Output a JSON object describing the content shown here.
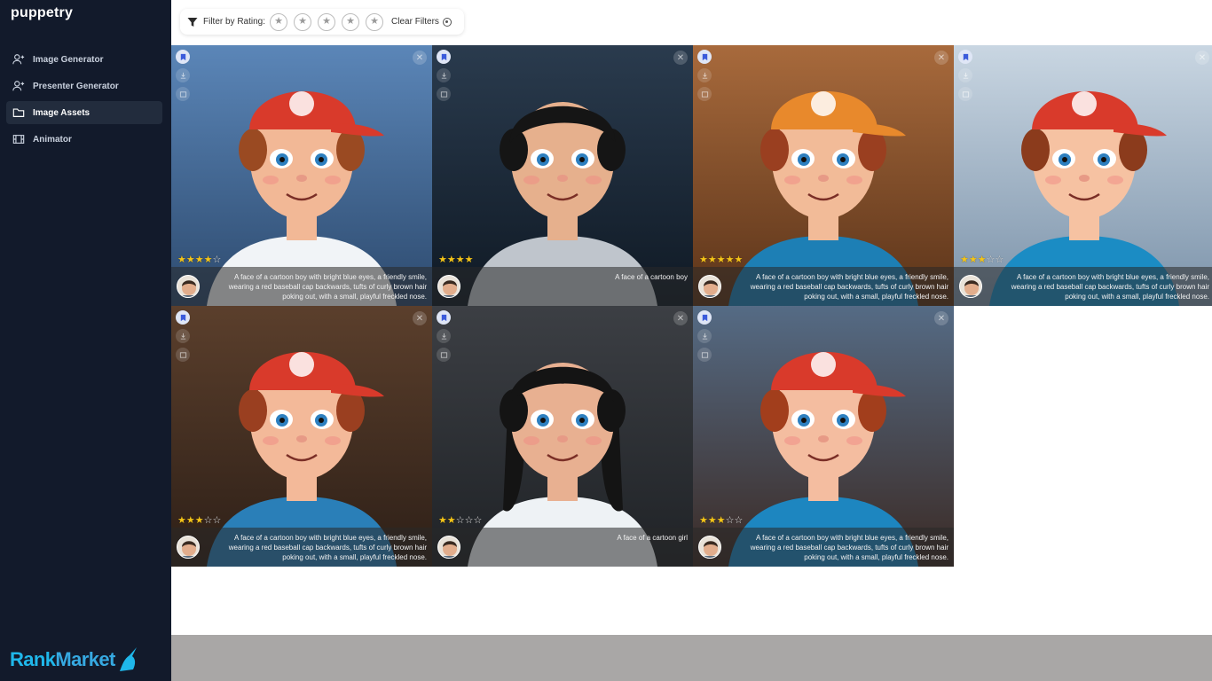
{
  "app": {
    "logo": "puppetry"
  },
  "sidebar": {
    "items": [
      {
        "label": "Image Generator",
        "icon": "user-plus-icon"
      },
      {
        "label": "Presenter Generator",
        "icon": "user-plus-icon"
      },
      {
        "label": "Image Assets",
        "icon": "folder-icon",
        "active": true
      },
      {
        "label": "Animator",
        "icon": "film-icon"
      }
    ]
  },
  "filter": {
    "label": "Filter by Rating:",
    "stars": [
      "★",
      "★",
      "★",
      "★",
      "★"
    ],
    "clear_label": "Clear Filters"
  },
  "cards": [
    {
      "rating_on": "★★★★",
      "rating_off": "☆",
      "caption": "A face of a cartoon boy with bright blue eyes, a friendly smile, wearing a red baseball cap backwards, tufts of curly brown hair poking out, with a small, playful freckled nose."
    },
    {
      "rating_on": "★★★★",
      "rating_off": "",
      "caption": "A face of a cartoon boy"
    },
    {
      "rating_on": "★★★★★",
      "rating_off": "",
      "caption": "A face of a cartoon boy with bright blue eyes, a friendly smile, wearing a red baseball cap backwards, tufts of curly brown hair poking out, with a small, playful freckled nose."
    },
    {
      "rating_on": "★★★",
      "rating_off": "☆☆",
      "caption": "A face of a cartoon boy with bright blue eyes, a friendly smile, wearing a red baseball cap backwards, tufts of curly brown hair poking out, with a small, playful freckled nose."
    },
    {
      "rating_on": "★★★",
      "rating_off": "☆☆",
      "caption": "A face of a cartoon boy with bright blue eyes, a friendly smile, wearing a red baseball cap backwards, tufts of curly brown hair poking out, with a small, playful freckled nose."
    },
    {
      "rating_on": "★★",
      "rating_off": "☆☆☆",
      "caption": "A face of a cartoon girl"
    },
    {
      "rating_on": "★★★",
      "rating_off": "☆☆",
      "caption": "A face of a cartoon boy with bright blue eyes, a friendly smile, wearing a red baseball cap backwards, tufts of curly brown hair poking out, with a small, playful freckled nose."
    }
  ],
  "footer": {
    "brand_rank": "Rank",
    "brand_market": "Market"
  },
  "colors": {
    "sidebar": "#121a2b",
    "star": "#f5c518",
    "cap_red": "#d93a2b"
  }
}
